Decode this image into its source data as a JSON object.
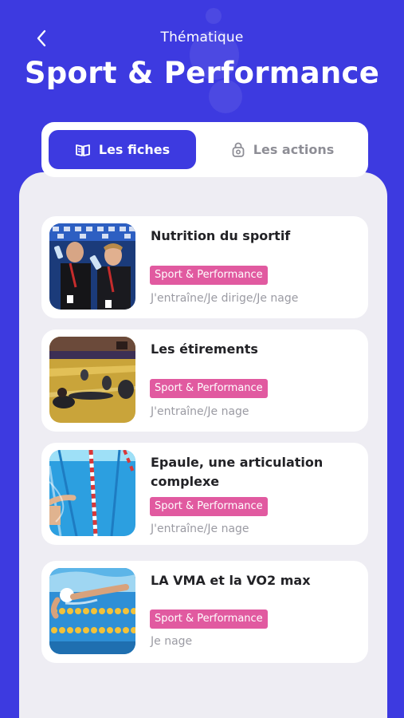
{
  "header": {
    "subtitle": "Thématique",
    "title": "Sport & Performance"
  },
  "tabs": [
    {
      "label": "Les fiches",
      "icon": "book-icon",
      "active": true
    },
    {
      "label": "Les actions",
      "icon": "lock-icon",
      "active": false
    }
  ],
  "cards": [
    {
      "title": "Nutrition du sportif",
      "tag": "Sport & Performance",
      "audience": "J'entraîne/Je dirige/Je nage"
    },
    {
      "title": "Les étirements",
      "tag": "Sport & Performance",
      "audience": "J'entraîne/Je nage"
    },
    {
      "title": "Epaule, une articulation complexe",
      "tag": "Sport & Performance",
      "audience": "J'entraîne/Je nage"
    },
    {
      "title": "LA VMA et la VO2 max",
      "tag": "Sport & Performance",
      "audience": "Je nage"
    }
  ],
  "colors": {
    "primary": "#3d3ae0",
    "tag": "#e15aa0",
    "background": "#eeedf3"
  }
}
